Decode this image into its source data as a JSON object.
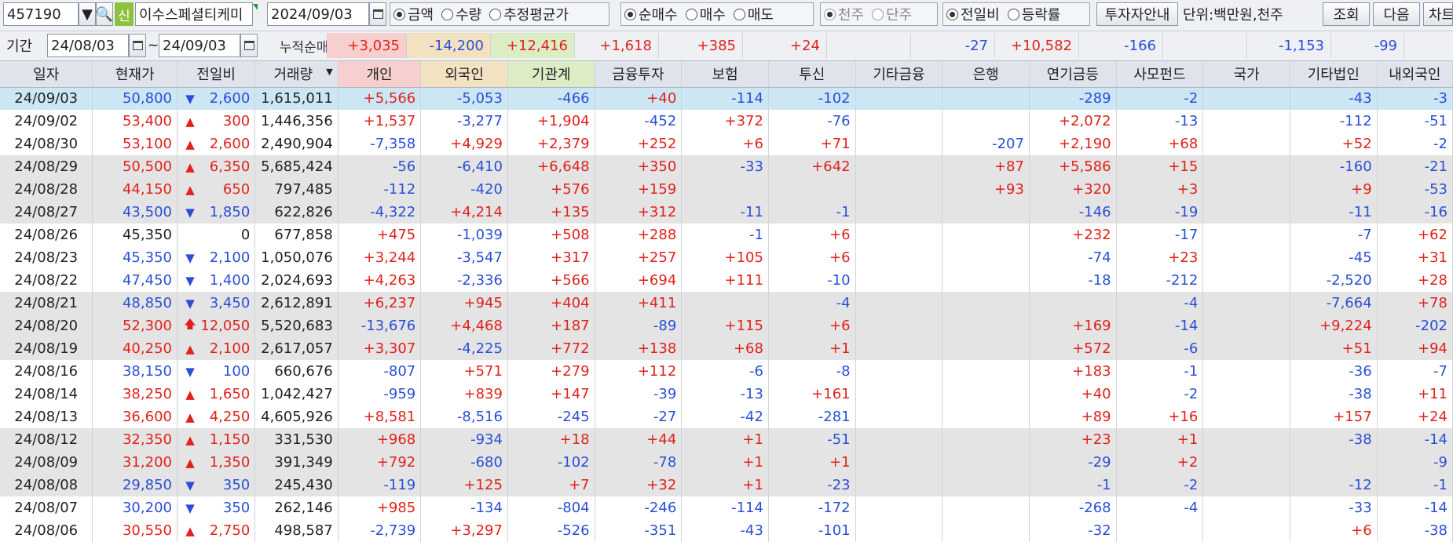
{
  "toolbar": {
    "code": "457190",
    "new_badge": "신",
    "stock_name": "이수스페셜티케미",
    "date": "2024/09/03",
    "radio_amount": "금액",
    "radio_qty": "수량",
    "radio_avg": "추정평균가",
    "radio_net": "순매수",
    "radio_buy": "매수",
    "radio_sell": "매도",
    "radio_thousand": "천주",
    "radio_unit": "단주",
    "radio_prev": "전일비",
    "radio_rate": "등락률",
    "investor_btn": "투자자안내",
    "unit_text": "단위:백만원,천주",
    "query_btn": "조회",
    "next_btn": "다음",
    "chart_btn": "차트"
  },
  "period": {
    "label": "기간",
    "from": "24/08/03",
    "tilde": "~",
    "to": "24/09/03",
    "cum_label": "누적순매수",
    "cum_values": [
      "+3,035",
      "-14,200",
      "+12,416",
      "+1,618",
      "+385",
      "+24",
      "",
      "-27",
      "+10,582",
      "-166",
      "",
      "-1,153",
      "-99"
    ]
  },
  "columns": [
    "일자",
    "현재가",
    "전일비",
    "거래량",
    "개인",
    "외국인",
    "기관계",
    "금융투자",
    "보험",
    "투신",
    "기타금융",
    "은행",
    "연기금등",
    "사모펀드",
    "국가",
    "기타법인",
    "내외국인"
  ],
  "colors": {
    "up": "#e0221c",
    "down": "#2a4fd6",
    "selected": "#cde6f4",
    "band_gray": "#e4e4e4",
    "individual_header": "#f8cfcf",
    "foreign_header": "#f3e2c2",
    "inst_header": "#dcedc6"
  },
  "rows": [
    {
      "date": "24/09/03",
      "price": "50,800",
      "dir": "down",
      "diff": "2,600",
      "vol": "1,615,011",
      "v": [
        "+5,566",
        "-5,053",
        "-466",
        "+40",
        "-114",
        "-102",
        "",
        "",
        "-289",
        "-2",
        "",
        "-43",
        "-3"
      ]
    },
    {
      "date": "24/09/02",
      "price": "53,400",
      "dir": "up",
      "diff": "300",
      "vol": "1,446,356",
      "v": [
        "+1,537",
        "-3,277",
        "+1,904",
        "-452",
        "+372",
        "-76",
        "",
        "",
        "+2,072",
        "-13",
        "",
        "-112",
        "-51"
      ]
    },
    {
      "date": "24/08/30",
      "price": "53,100",
      "dir": "up",
      "diff": "2,600",
      "vol": "2,490,904",
      "v": [
        "-7,358",
        "+4,929",
        "+2,379",
        "+252",
        "+6",
        "+71",
        "",
        "-207",
        "+2,190",
        "+68",
        "",
        "+52",
        "-2"
      ]
    },
    {
      "date": "24/08/29",
      "price": "50,500",
      "dir": "up",
      "diff": "6,350",
      "vol": "5,685,424",
      "v": [
        "-56",
        "-6,410",
        "+6,648",
        "+350",
        "-33",
        "+642",
        "",
        "+87",
        "+5,586",
        "+15",
        "",
        "-160",
        "-21"
      ]
    },
    {
      "date": "24/08/28",
      "price": "44,150",
      "dir": "up",
      "diff": "650",
      "vol": "797,485",
      "v": [
        "-112",
        "-420",
        "+576",
        "+159",
        "",
        "",
        "",
        "+93",
        "+320",
        "+3",
        "",
        "+9",
        "-53"
      ]
    },
    {
      "date": "24/08/27",
      "price": "43,500",
      "dir": "down",
      "diff": "1,850",
      "vol": "622,826",
      "v": [
        "-4,322",
        "+4,214",
        "+135",
        "+312",
        "-11",
        "-1",
        "",
        "",
        "-146",
        "-19",
        "",
        "-11",
        "-16"
      ]
    },
    {
      "date": "24/08/26",
      "price": "45,350",
      "dir": "none",
      "diff": "0",
      "vol": "677,858",
      "v": [
        "+475",
        "-1,039",
        "+508",
        "+288",
        "-1",
        "+6",
        "",
        "",
        "+232",
        "-17",
        "",
        "-7",
        "+62"
      ]
    },
    {
      "date": "24/08/23",
      "price": "45,350",
      "dir": "down",
      "diff": "2,100",
      "vol": "1,050,076",
      "v": [
        "+3,244",
        "-3,547",
        "+317",
        "+257",
        "+105",
        "+6",
        "",
        "",
        "-74",
        "+23",
        "",
        "-45",
        "+31"
      ]
    },
    {
      "date": "24/08/22",
      "price": "47,450",
      "dir": "down",
      "diff": "1,400",
      "vol": "2,024,693",
      "v": [
        "+4,263",
        "-2,336",
        "+566",
        "+694",
        "+111",
        "-10",
        "",
        "",
        "-18",
        "-212",
        "",
        "-2,520",
        "+28"
      ]
    },
    {
      "date": "24/08/21",
      "price": "48,850",
      "dir": "down",
      "diff": "3,450",
      "vol": "2,612,891",
      "v": [
        "+6,237",
        "+945",
        "+404",
        "+411",
        "",
        "-4",
        "",
        "",
        "",
        "-4",
        "",
        "-7,664",
        "+78"
      ]
    },
    {
      "date": "24/08/20",
      "price": "52,300",
      "dir": "limit",
      "diff": "12,050",
      "vol": "5,520,683",
      "v": [
        "-13,676",
        "+4,468",
        "+187",
        "-89",
        "+115",
        "+6",
        "",
        "",
        "+169",
        "-14",
        "",
        "+9,224",
        "-202"
      ]
    },
    {
      "date": "24/08/19",
      "price": "40,250",
      "dir": "up",
      "diff": "2,100",
      "vol": "2,617,057",
      "v": [
        "+3,307",
        "-4,225",
        "+772",
        "+138",
        "+68",
        "+1",
        "",
        "",
        "+572",
        "-6",
        "",
        "+51",
        "+94"
      ]
    },
    {
      "date": "24/08/16",
      "price": "38,150",
      "dir": "down",
      "diff": "100",
      "vol": "660,676",
      "v": [
        "-807",
        "+571",
        "+279",
        "+112",
        "-6",
        "-8",
        "",
        "",
        "+183",
        "-1",
        "",
        "-36",
        "-7"
      ]
    },
    {
      "date": "24/08/14",
      "price": "38,250",
      "dir": "up",
      "diff": "1,650",
      "vol": "1,042,427",
      "v": [
        "-959",
        "+839",
        "+147",
        "-39",
        "-13",
        "+161",
        "",
        "",
        "+40",
        "-2",
        "",
        "-38",
        "+11"
      ]
    },
    {
      "date": "24/08/13",
      "price": "36,600",
      "dir": "up",
      "diff": "4,250",
      "vol": "4,605,926",
      "v": [
        "+8,581",
        "-8,516",
        "-245",
        "-27",
        "-42",
        "-281",
        "",
        "",
        "+89",
        "+16",
        "",
        "+157",
        "+24"
      ]
    },
    {
      "date": "24/08/12",
      "price": "32,350",
      "dir": "up",
      "diff": "1,150",
      "vol": "331,530",
      "v": [
        "+968",
        "-934",
        "+18",
        "+44",
        "+1",
        "-51",
        "",
        "",
        "+23",
        "+1",
        "",
        "-38",
        "-14"
      ]
    },
    {
      "date": "24/08/09",
      "price": "31,200",
      "dir": "up",
      "diff": "1,350",
      "vol": "391,349",
      "v": [
        "+792",
        "-680",
        "-102",
        "-78",
        "+1",
        "+1",
        "",
        "",
        "-29",
        "+2",
        "",
        "",
        "-9"
      ]
    },
    {
      "date": "24/08/08",
      "price": "29,850",
      "dir": "down",
      "diff": "350",
      "vol": "245,430",
      "v": [
        "-119",
        "+125",
        "+7",
        "+32",
        "+1",
        "-23",
        "",
        "",
        "-1",
        "-2",
        "",
        "-12",
        "-1"
      ]
    },
    {
      "date": "24/08/07",
      "price": "30,200",
      "dir": "down",
      "diff": "350",
      "vol": "262,146",
      "v": [
        "+985",
        "-134",
        "-804",
        "-246",
        "-114",
        "-172",
        "",
        "",
        "-268",
        "-4",
        "",
        "-33",
        "-14"
      ]
    },
    {
      "date": "24/08/06",
      "price": "30,550",
      "dir": "up",
      "diff": "2,750",
      "vol": "498,587",
      "v": [
        "-2,739",
        "+3,297",
        "-526",
        "-351",
        "-43",
        "-101",
        "",
        "",
        "-32",
        "",
        "",
        "+6",
        "-38"
      ]
    }
  ]
}
